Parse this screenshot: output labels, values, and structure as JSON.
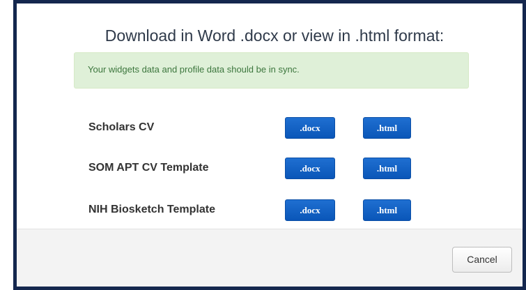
{
  "modal": {
    "title": "Download in Word .docx or view in .html format:",
    "alert": "Your widgets data and profile data should be in sync.",
    "cancel_label": "Cancel"
  },
  "cv_templates": [
    {
      "name": "Scholars CV",
      "docx_label": ".docx",
      "html_label": ".html"
    },
    {
      "name": "SOM APT CV Template",
      "docx_label": ".docx",
      "html_label": ".html"
    },
    {
      "name": "NIH Biosketch Template",
      "docx_label": ".docx",
      "html_label": ".html"
    }
  ],
  "colors": {
    "frame_border": "#14274e",
    "primary_button": "#0a56b8",
    "alert_background": "#dff0d8",
    "alert_text": "#3c763d",
    "footer_background": "#f3f3f3"
  }
}
